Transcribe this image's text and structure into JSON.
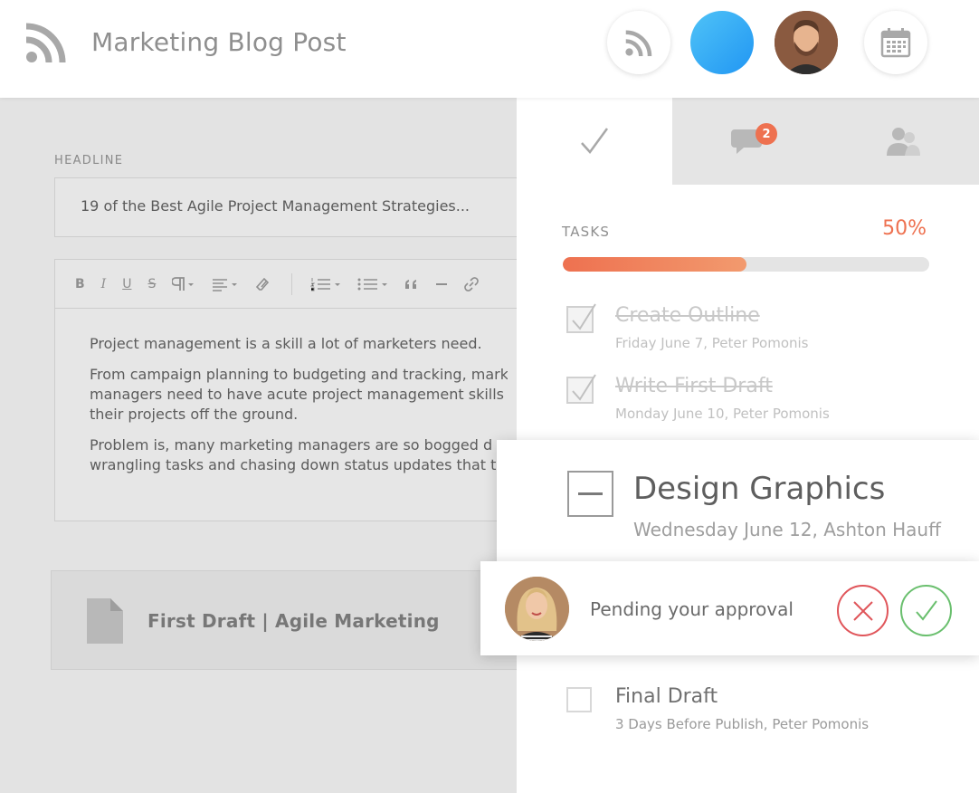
{
  "header": {
    "title": "Marketing Blog Post",
    "icons": [
      "rss-icon",
      "rss-button-icon",
      "calendar-icon"
    ],
    "blue_accent": "#2196f3"
  },
  "editor": {
    "headline_label": "HEADLINE",
    "headline_value": "19 of the Best Agile Project Management Strategies...",
    "toolbar": [
      "B",
      "I",
      "U",
      "S"
    ],
    "paragraphs": [
      "Project management is a skill a lot of marketers need.",
      "From campaign planning to budgeting and tracking, marke",
      "managers need to have acute project management skills t",
      "their projects off the ground.",
      "Problem is, many marketing managers are so bogged d",
      "wrangling tasks and chasing down status updates that t"
    ]
  },
  "attachment": {
    "name": "First Draft | Agile Marketing"
  },
  "panel": {
    "comments_badge": "2",
    "tasks_label": "TASKS",
    "progress_text": "50%",
    "progress_value": 0.5,
    "accent_color": "#ee7150",
    "tasks": [
      {
        "name": "Create Outline",
        "meta": "Friday June 7,  Peter Pomonis",
        "done": true
      },
      {
        "name": "Write First Draft",
        "meta": "Monday June 10,  Peter Pomonis",
        "done": true
      },
      {
        "name": "Design Graphics",
        "meta": "Wednesday June 12, Ashton Hauff",
        "done": false
      },
      {
        "name": "Final Draft",
        "meta": "3 Days Before Publish, Peter Pomonis",
        "done": false
      }
    ],
    "approval_text": "Pending your approval"
  }
}
